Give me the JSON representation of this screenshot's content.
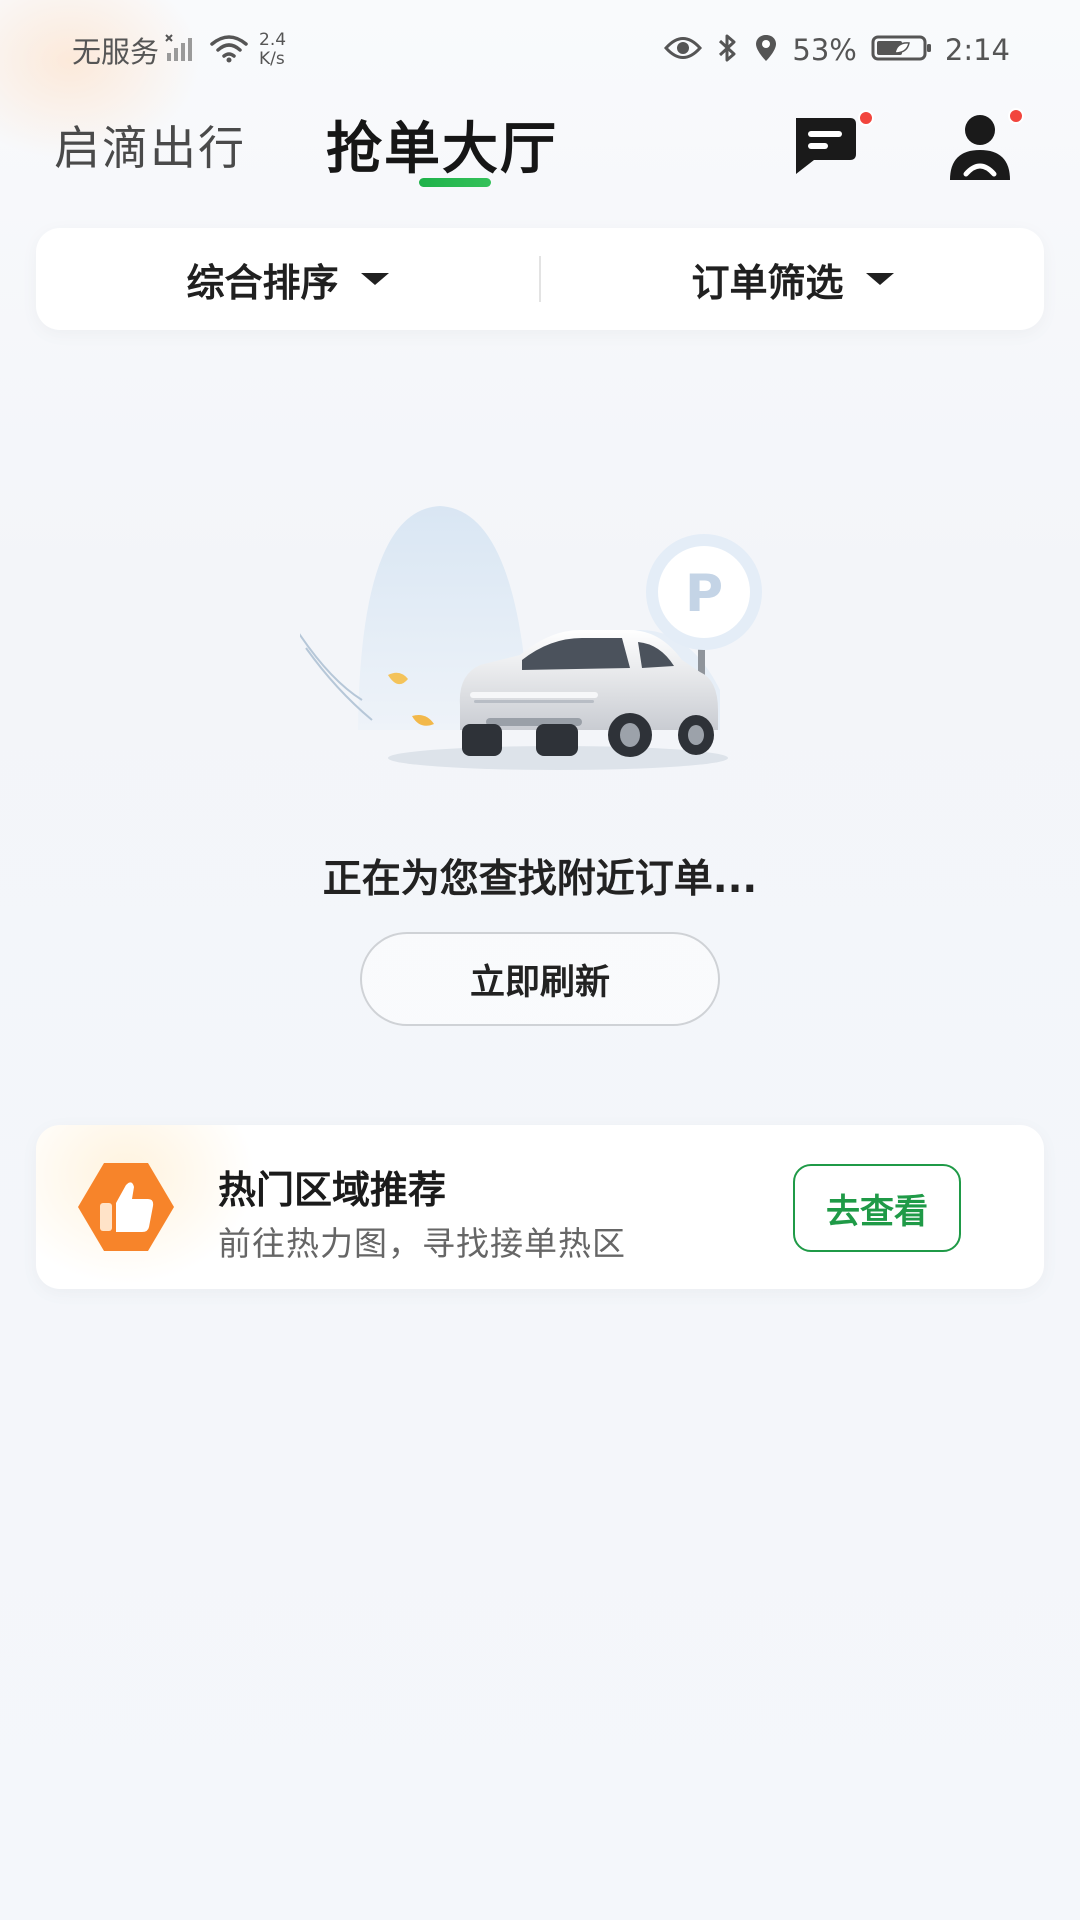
{
  "status_bar": {
    "carrier": "无服务",
    "net_speed_value": "2.4",
    "net_speed_unit": "K/s",
    "battery": "53%",
    "time": "2:14",
    "icons": [
      "signal-no-service-icon",
      "wifi-icon",
      "eye-icon",
      "bluetooth-icon",
      "location-icon",
      "battery-icon"
    ]
  },
  "header": {
    "tab_inactive": "启滴出行",
    "tab_active": "抢单大厅",
    "indicator_color": "#1fb24a",
    "message_icon": "message-icon",
    "user_icon": "driver-avatar-icon",
    "badge_color": "#f2453d"
  },
  "filters": {
    "sort_label": "综合排序",
    "filter_label": "订单筛选"
  },
  "empty_state": {
    "illustration": "car-parking-illustration",
    "message": "正在为您查找附近订单...",
    "refresh_label": "立即刷新"
  },
  "hot_zone": {
    "icon": "thumbs-up-icon",
    "title": "热门区域推荐",
    "subtitle": "前往热力图，寻找接单热区",
    "button_label": "去查看",
    "accent_color": "#1f9a47",
    "icon_color": "#f7842a"
  }
}
